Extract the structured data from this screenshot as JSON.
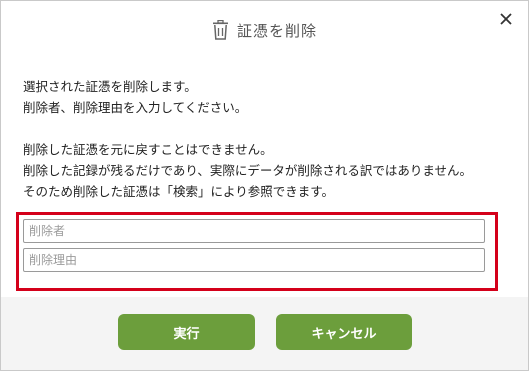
{
  "dialog": {
    "title": "証憑を削除",
    "title_icon": "trash-icon",
    "close_icon": "close-icon"
  },
  "message": {
    "line1": "選択された証憑を削除します。",
    "line2": "削除者、削除理由を入力してください。",
    "line3": "削除した証憑を元に戻すことはできません。",
    "line4": "削除した記録が残るだけであり、実際にデータが削除される訳ではありません。",
    "line5": "そのため削除した証憑は「検索」により参照できます。"
  },
  "form": {
    "deleter_placeholder": "削除者",
    "deleter_value": "",
    "reason_placeholder": "削除理由",
    "reason_value": ""
  },
  "buttons": {
    "execute_label": "実行",
    "cancel_label": "キャンセル"
  },
  "colors": {
    "button_green": "#6c9e3c",
    "highlight_red": "#d4001a",
    "footer_bg": "#f4f4f4"
  }
}
